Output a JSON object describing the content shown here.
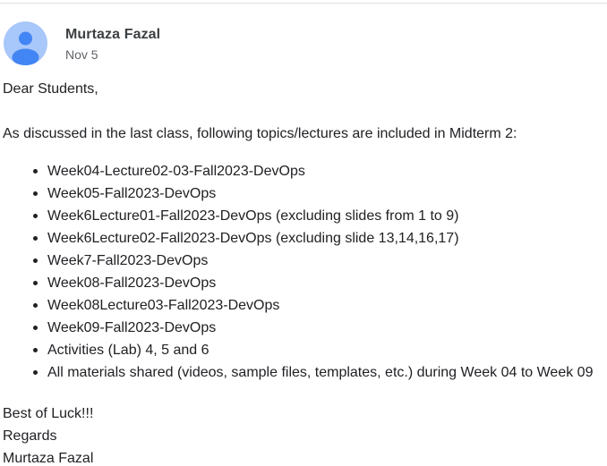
{
  "email": {
    "sender": "Murtaza Fazal",
    "date": "Nov 5",
    "greeting": "Dear Students,",
    "intro": "As discussed in the last class, following topics/lectures are included in Midterm 2:",
    "topics": [
      "Week04-Lecture02-03-Fall2023-DevOps",
      "Week05-Fall2023-DevOps",
      "Week6Lecture01-Fall2023-DevOps (excluding slides from 1 to 9)",
      "Week6Lecture02-Fall2023-DevOps (excluding slide 13,14,16,17)",
      "Week7-Fall2023-DevOps",
      "Week08-Fall2023-DevOps",
      "Week08Lecture03-Fall2023-DevOps",
      "Week09-Fall2023-DevOps",
      "Activities (Lab) 4, 5 and 6",
      "All materials shared (videos, sample files, templates, etc.) during Week 04 to Week 09"
    ],
    "closing": "Best of Luck!!!",
    "regards": "Regards",
    "signature": "Murtaza Fazal"
  },
  "avatar": {
    "icon": "person-icon",
    "background_color": "#a8c7fa",
    "figure_color": "#4285f4"
  }
}
